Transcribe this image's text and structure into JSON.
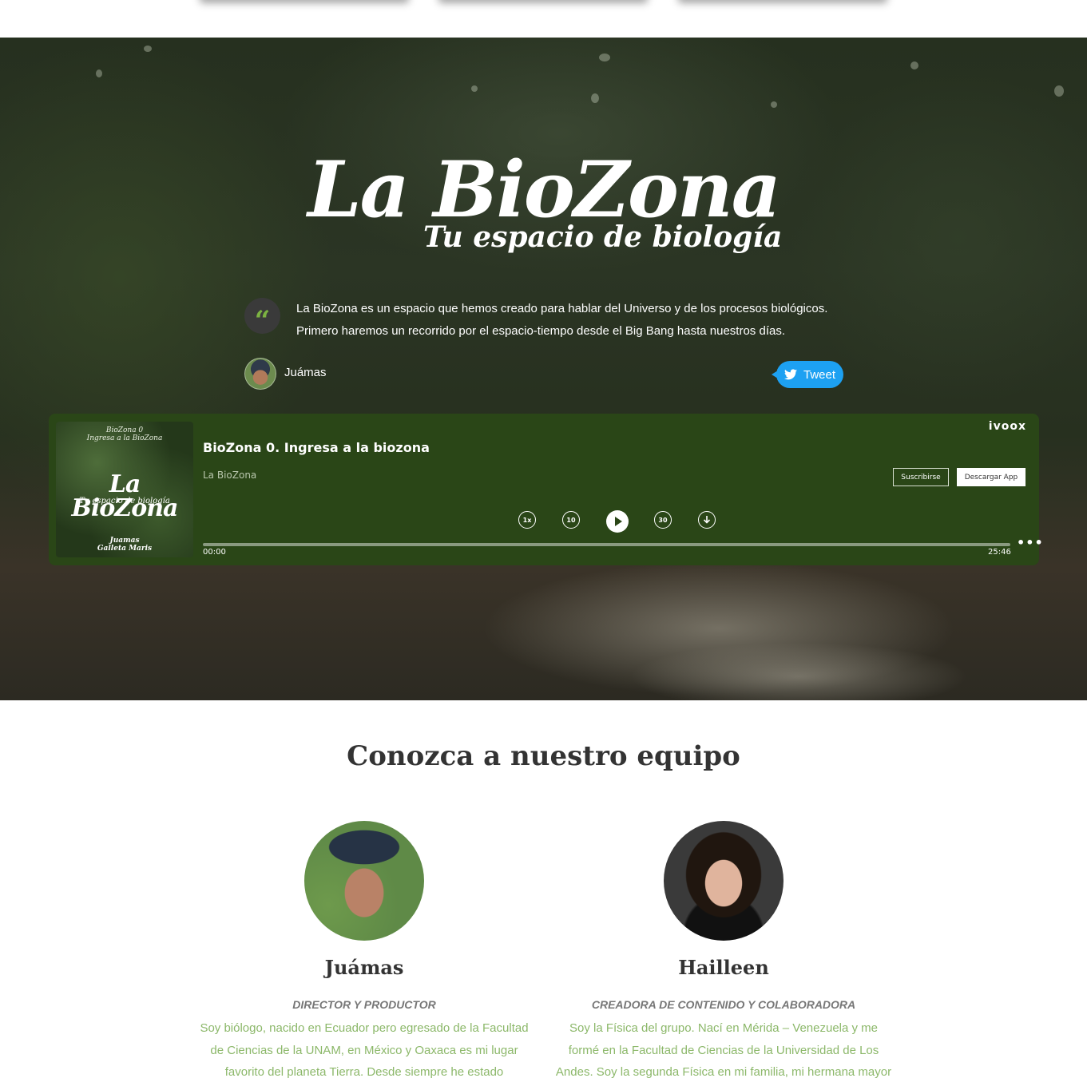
{
  "hero": {
    "logo_title": "La BioZona",
    "logo_subtitle": "Tu espacio de biología",
    "quote_icon": "quote-icon",
    "quote": "La BioZona es un espacio que hemos creado para hablar del Universo y de los procesos biológicos. Primero haremos un recorrido por el espacio-tiempo desde el Big Bang hasta nuestros días.",
    "author": "Juámas",
    "tweet_label": "Tweet",
    "tweet_icon": "twitter-bird-icon"
  },
  "player": {
    "brand": "ivoox",
    "episode_title": "BioZona 0. Ingresa a la biozona",
    "show_name": "La BioZona",
    "subscribe_label": "Suscribirse",
    "download_label": "Descargar App",
    "cover": {
      "top_text": "BioZona 0\nIngresa a la BioZona",
      "logo": "La BioZona",
      "subtitle": "Tu espacio de biología",
      "bottom_text": "Juamas\nGalleta Maris"
    },
    "controls": {
      "speed": "1x",
      "rewind": "10",
      "forward": "30"
    },
    "current_time": "00:00",
    "total_time": "25:46",
    "progress": 0.0
  },
  "team": {
    "heading": "Conozca a nuestro equipo",
    "members": [
      {
        "name": "Juámas",
        "role": "DIRECTOR Y PRODUCTOR",
        "bio": "Soy biólogo, nacido en Ecuador pero egresado de la Facultad de Ciencias de la UNAM, en México y Oaxaca es mi lugar favorito del planeta Tierra. Desde siempre he estado interesado en la"
      },
      {
        "name": "Hailleen",
        "role": "CREADORA DE CONTENIDO Y COLABORADORA",
        "bio": "Soy la Física del grupo. Nací en Mérida – Venezuela y me formé en la Facultad de Ciencias de la Universidad de Los Andes. Soy la segunda Física en mi familia, mi hermana mayor también lo"
      }
    ]
  },
  "colors": {
    "player_bg": "#2a4617",
    "accent_green": "#7cb342",
    "bio_green": "#8cb86a",
    "tweet_blue": "#1da1f2"
  }
}
